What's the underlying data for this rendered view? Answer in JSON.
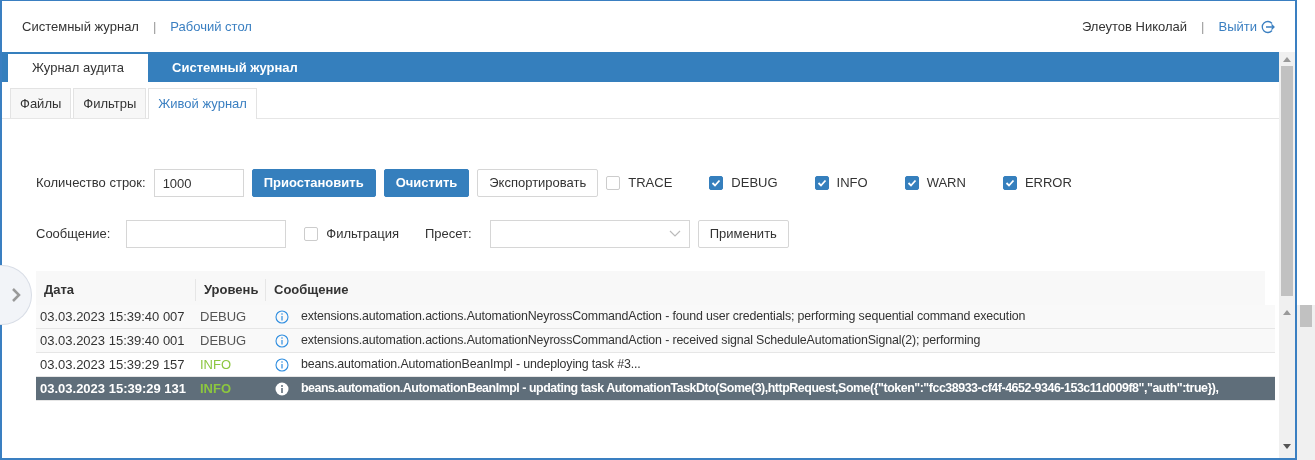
{
  "header": {
    "title": "Системный журнал",
    "separator_left": "|",
    "link": "Рабочий стол",
    "user": "Элеутов Николай",
    "separator_right": "|",
    "logout": "Выйти"
  },
  "main_tabs": [
    {
      "label": "Журнал аудита",
      "selected": true
    },
    {
      "label": "Системный журнал",
      "selected": false
    }
  ],
  "sub_tabs": [
    {
      "label": "Файлы",
      "selected": false
    },
    {
      "label": "Фильтры",
      "selected": false
    },
    {
      "label": "Живой журнал",
      "selected": true
    }
  ],
  "controls": {
    "rows_label": "Количество строк:",
    "rows_value": "1000",
    "buttons": [
      {
        "label": "Приостановить",
        "kind": "primary"
      },
      {
        "label": "Очистить",
        "kind": "primary"
      },
      {
        "label": "Экспортировать",
        "kind": "secondary"
      }
    ],
    "levels": [
      {
        "label": "TRACE",
        "checked": false
      },
      {
        "label": "DEBUG",
        "checked": true
      },
      {
        "label": "INFO",
        "checked": true
      },
      {
        "label": "WARN",
        "checked": true
      },
      {
        "label": "ERROR",
        "checked": true
      }
    ]
  },
  "filter": {
    "message_label": "Сообщение:",
    "filter_checkbox": {
      "label": "Фильтрация",
      "checked": false
    },
    "preset_label": "Пресет:",
    "apply_button": "Применить"
  },
  "table": {
    "columns": [
      "Дата",
      "Уровень",
      "Сообщение"
    ],
    "rows": [
      {
        "date": "03.03.2023 15:39:40 007",
        "level": "DEBUG",
        "kind": "debug",
        "message": "extensions.automation.actions.AutomationNeyrossCommandAction - found user credentials; performing sequential command execution",
        "selected": false
      },
      {
        "date": "03.03.2023 15:39:40 001",
        "level": "DEBUG",
        "kind": "debug",
        "message": "extensions.automation.actions.AutomationNeyrossCommandAction - received signal ScheduleAutomationSignal(2); performing",
        "selected": false
      },
      {
        "date": "03.03.2023 15:39:29 157",
        "level": "INFO",
        "kind": "info",
        "message": "beans.automation.AutomationBeanImpl - undeploying task #3...",
        "selected": false
      },
      {
        "date": "03.03.2023 15:39:29 131",
        "level": "INFO",
        "kind": "info",
        "message": "beans.automation.AutomationBeanImpl - updating task AutomationTaskDto(Some(3),httpRequest,Some({\"token\":\"fcc38933-cf4f-4652-9346-153c11d009f8\",\"auth\":true}),",
        "selected": true
      }
    ]
  }
}
